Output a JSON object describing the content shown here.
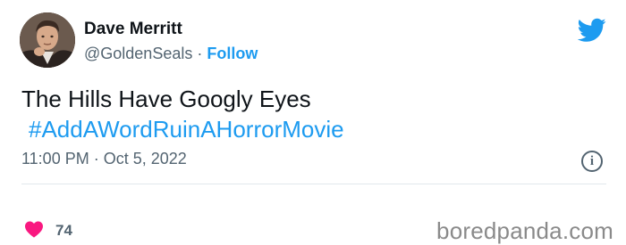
{
  "author": {
    "name": "Dave Merritt",
    "handle": "@GoldenSeals",
    "separator": "·",
    "follow_label": "Follow",
    "avatar_icon": "profile-photo"
  },
  "tweet": {
    "text": "The Hills Have Googly Eyes",
    "hashtag": "#AddAWordRuinAHorrorMovie"
  },
  "meta": {
    "time": "11:00 PM",
    "separator": "·",
    "date": "Oct 5, 2022",
    "info_glyph": "i"
  },
  "engagement": {
    "likes": "74",
    "like_icon": "heart-icon"
  },
  "brand": {
    "platform_icon": "twitter-bird-icon",
    "watermark": "boredpanda.com"
  },
  "colors": {
    "link": "#1d9bf0",
    "heart": "#f91880",
    "secondary_text": "#536471"
  }
}
